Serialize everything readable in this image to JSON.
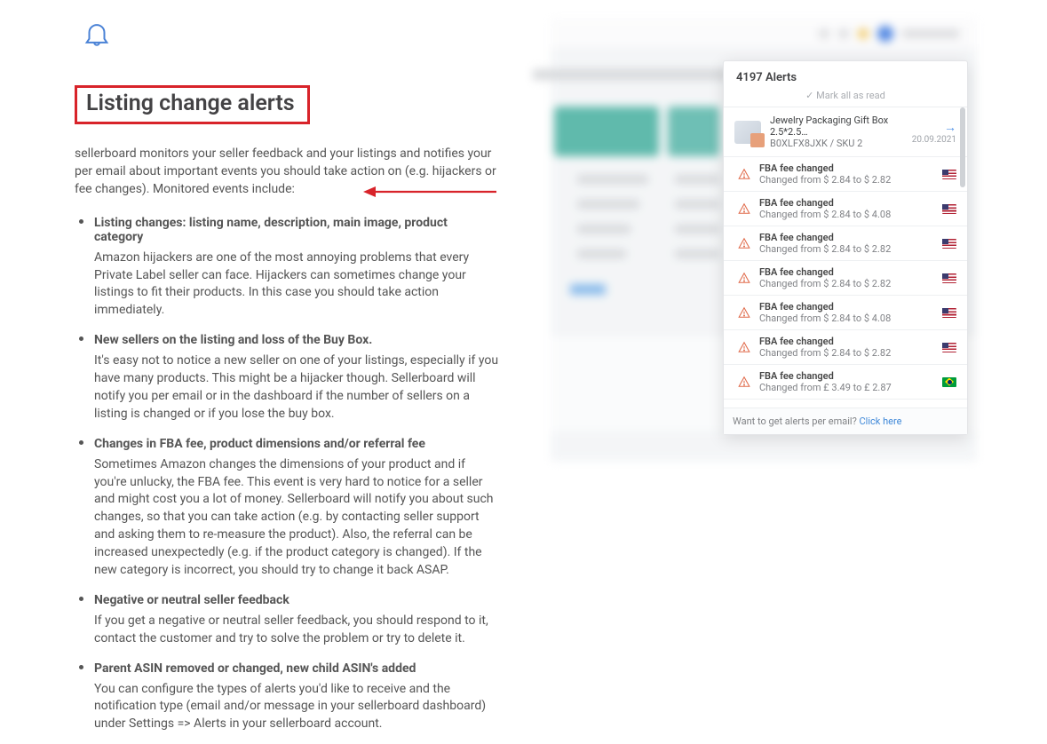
{
  "title": "Listing change alerts",
  "intro": "sellerboard monitors your seller feedback and your listings and notifies your per email about important events you should take action on (e.g. hijackers or fee changes). Monitored events include:",
  "features": [
    {
      "title": "Listing changes: listing name, description, main image, product category",
      "body": "Amazon hijackers are one of the most annoying problems that every Private Label seller can face. Hijackers can sometimes change your listings to fit their products. In this case you should take action immediately."
    },
    {
      "title": "New sellers on the listing and loss of the Buy Box.",
      "body": "It's easy not to notice a new seller on one of your listings, especially if you have many products. This might be a hijacker though. Sellerboard will notify you per email or in the dashboard if the number of sellers on a listing is changed or if you lose the buy box."
    },
    {
      "title": "Changes in FBA fee, product dimensions and/or referral fee",
      "body": "Sometimes Amazon changes the dimensions of your product and if you're unlucky, the FBA fee. This event is very hard to notice for a seller and might cost you a lot of money. Sellerboard will notify you about such changes, so that you can take action (e.g. by contacting seller support and asking them to re-measure the product). Also, the referral can be increased unexpectedly (e.g. if the product category is changed). If the new category is incorrect, you should try to change it back ASAP."
    },
    {
      "title": "Negative or neutral seller feedback",
      "body": "If you get a negative or neutral seller feedback, you should respond to it, contact the customer and try to solve the problem or try to delete it."
    },
    {
      "title": "Parent ASIN removed or changed, new child ASIN's added",
      "body": "You can configure the types of alerts you'd like to receive and the notification type (email and/or message in your sellerboard dashboard) under Settings => Alerts in your sellerboard account."
    }
  ],
  "panel": {
    "header": "4197 Alerts",
    "mark_all": "Mark all as read",
    "product": {
      "title": "Jewelry Packaging Gift Box 2.5*2.5…",
      "sku": "B0XLFX8JXK / SKU 2",
      "date": "20.09.2021"
    },
    "alerts": [
      {
        "title": "FBA fee changed",
        "sub": "Changed from $ 2.84 to $ 2.82",
        "flag": "us"
      },
      {
        "title": "FBA fee changed",
        "sub": "Changed from $ 2.84 to $ 4.08",
        "flag": "us"
      },
      {
        "title": "FBA fee changed",
        "sub": "Changed from $ 2.84 to $ 2.82",
        "flag": "us"
      },
      {
        "title": "FBA fee changed",
        "sub": "Changed from $ 2.84 to $ 2.82",
        "flag": "us"
      },
      {
        "title": "FBA fee changed",
        "sub": "Changed from $ 2.84 to $ 4.08",
        "flag": "us"
      },
      {
        "title": "FBA fee changed",
        "sub": "Changed from $ 2.84 to $ 2.82",
        "flag": "us"
      },
      {
        "title": "FBA fee changed",
        "sub": "Changed from £ 3.49 to £ 2.87",
        "flag": "br"
      }
    ],
    "footer_text": "Want to get alerts per email? ",
    "footer_link": "Click here"
  }
}
